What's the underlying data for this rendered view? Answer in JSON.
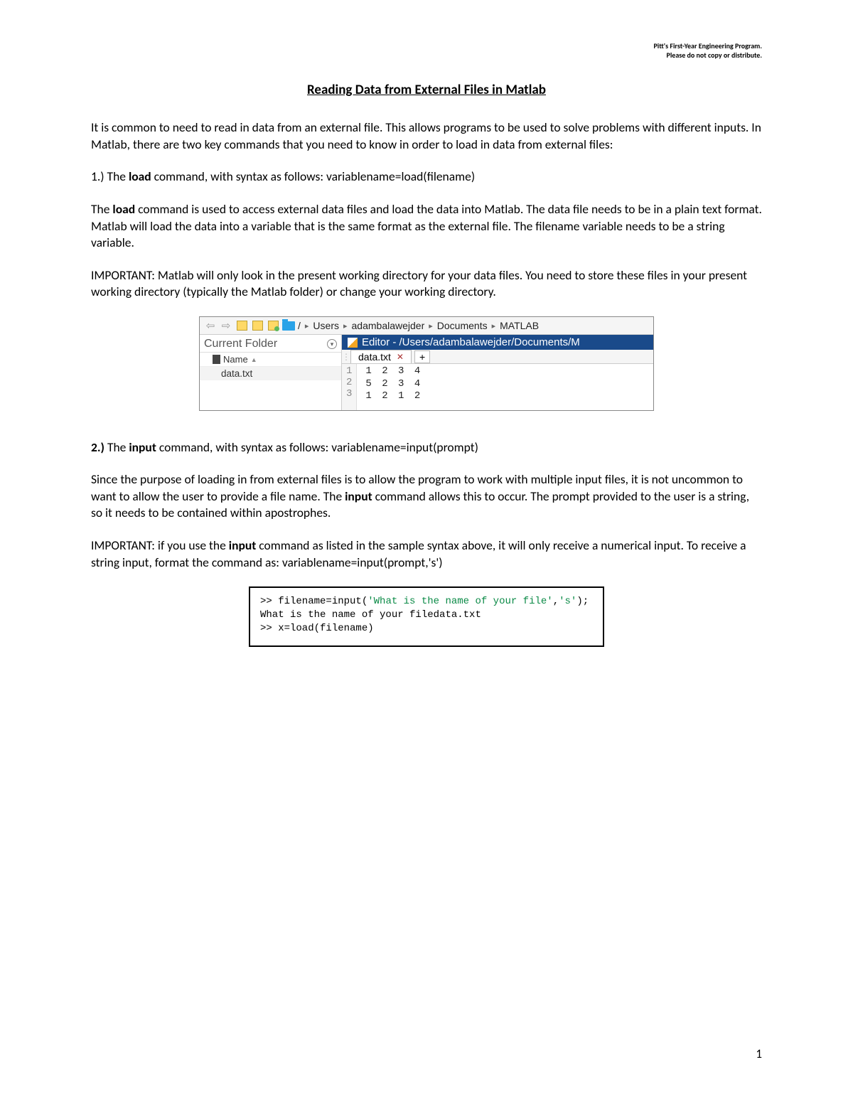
{
  "header": {
    "line1": "Pitt's First-Year Engineering Program.",
    "line2": "Please do not copy or distribute."
  },
  "title": "Reading Data from External Files in Matlab",
  "p1": "It is common to need to read in data from an external file. This allows programs to be used to solve problems with different inputs. In Matlab, there are two key commands that you need to know in order to load in data from external files:",
  "item1_lead": "1.) The ",
  "item1_cmd": "load",
  "item1_rest": " command, with syntax as follows:    variablename=load(filename)",
  "p2a": "The ",
  "p2b": "load",
  "p2c": " command is used to access external data files and load the data into Matlab. The data file needs to be in a plain text format. Matlab will load the data into a variable that is the same format as the external file. The filename variable needs to be a string variable.",
  "p3": "IMPORTANT: Matlab will only look in the present working directory for your data files.  You need to store these files in your present working directory (typically the Matlab folder) or change your working directory.",
  "matlab": {
    "breadcrumb": [
      "/",
      "Users",
      "adambalawejder",
      "Documents",
      "MATLAB"
    ],
    "currentFolderLabel": "Current Folder",
    "nameHeader": "Name",
    "fileListed": "data.txt",
    "editorTitle": "Editor - /Users/adambalawejder/Documents/M",
    "tabName": "data.txt",
    "gutter": [
      "1",
      "2",
      "3"
    ],
    "lines": [
      "1 2 3 4",
      "5 2 3 4",
      "1 2 1 2"
    ]
  },
  "item2_lead": "2.) ",
  "item2_the": "The ",
  "item2_cmd": "input",
  "item2_rest": " command, with syntax as follows:    variablename=input(prompt)",
  "p4a": "Since the purpose of loading in from external files is to allow the program to work with multiple input files, it is not uncommon to want to allow the user to provide a file name. The ",
  "p4b": "input",
  "p4c": " command allows this to occur. The prompt provided to the user is a string, so it needs to be contained within apostrophes.",
  "p5a": "IMPORTANT: if you use the ",
  "p5b": "input",
  "p5c": " command as listed in the sample syntax above, it will only receive a numerical input.  To receive a string input, format the command as:    variablename=input(prompt,'s')",
  "cmd": {
    "l1a": ">> filename=input(",
    "l1b": "'What is the name of your file'",
    "l1c": ",",
    "l1d": "'s'",
    "l1e": ");",
    "l2": "What is the name of your filedata.txt",
    "l3": ">> x=load(filename)"
  },
  "pageNumber": "1"
}
